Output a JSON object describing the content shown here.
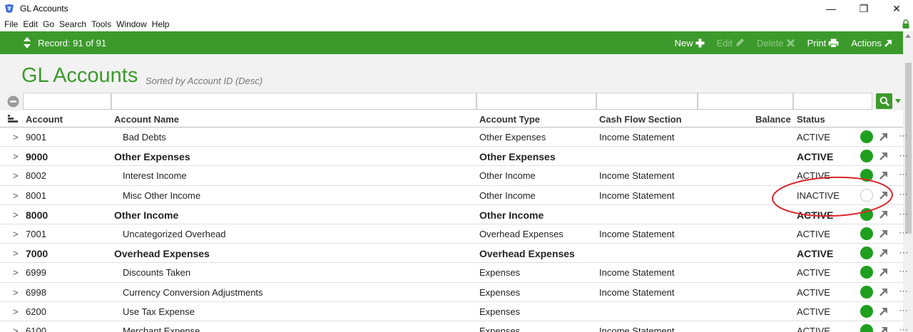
{
  "window": {
    "title": "GL Accounts",
    "minimize": "—",
    "maximize": "❐",
    "close": "✕"
  },
  "menu": [
    "File",
    "Edit",
    "Go",
    "Search",
    "Tools",
    "Window",
    "Help"
  ],
  "toolbar": {
    "record": "Record: 91 of 91",
    "new": "New",
    "edit": "Edit",
    "delete": "Delete",
    "print": "Print",
    "actions": "Actions"
  },
  "page": {
    "title": "GL Accounts",
    "sort_note": "Sorted by Account ID (Desc)"
  },
  "filters": [
    "",
    "",
    "",
    "",
    "",
    ""
  ],
  "columns": {
    "account": "Account",
    "name": "Account Name",
    "type": "Account Type",
    "cashflow": "Cash Flow Section",
    "balance": "Balance",
    "status": "Status"
  },
  "rows": [
    {
      "chev": ">",
      "account": "9001",
      "name": "Bad Debts",
      "type": "Other Expenses",
      "cashflow": "Income Statement",
      "balance": "",
      "status": "ACTIVE",
      "active": true,
      "header": false
    },
    {
      "chev": ">",
      "account": "9000",
      "name": "Other Expenses",
      "type": "Other Expenses",
      "cashflow": "",
      "balance": "",
      "status": "ACTIVE",
      "active": true,
      "header": true
    },
    {
      "chev": ">",
      "account": "8002",
      "name": "Interest Income",
      "type": "Other Income",
      "cashflow": "Income Statement",
      "balance": "",
      "status": "ACTIVE",
      "active": true,
      "header": false
    },
    {
      "chev": ">",
      "account": "8001",
      "name": "Misc Other Income",
      "type": "Other Income",
      "cashflow": "Income Statement",
      "balance": "",
      "status": "INACTIVE",
      "active": false,
      "header": false
    },
    {
      "chev": ">",
      "account": "8000",
      "name": "Other Income",
      "type": "Other Income",
      "cashflow": "",
      "balance": "",
      "status": "ACTIVE",
      "active": true,
      "header": true
    },
    {
      "chev": ">",
      "account": "7001",
      "name": "Uncategorized Overhead",
      "type": "Overhead Expenses",
      "cashflow": "Income Statement",
      "balance": "",
      "status": "ACTIVE",
      "active": true,
      "header": false
    },
    {
      "chev": ">",
      "account": "7000",
      "name": "Overhead Expenses",
      "type": "Overhead Expenses",
      "cashflow": "",
      "balance": "",
      "status": "ACTIVE",
      "active": true,
      "header": true
    },
    {
      "chev": ">",
      "account": "6999",
      "name": "Discounts Taken",
      "type": "Expenses",
      "cashflow": "Income Statement",
      "balance": "",
      "status": "ACTIVE",
      "active": true,
      "header": false
    },
    {
      "chev": ">",
      "account": "6998",
      "name": "Currency Conversion Adjustments",
      "type": "Expenses",
      "cashflow": "Income Statement",
      "balance": "",
      "status": "ACTIVE",
      "active": true,
      "header": false
    },
    {
      "chev": ">",
      "account": "6200",
      "name": "Use Tax Expense",
      "type": "Expenses",
      "cashflow": "",
      "balance": "",
      "status": "ACTIVE",
      "active": true,
      "header": false
    },
    {
      "chev": ">",
      "account": "6100",
      "name": "Merchant Expense",
      "type": "Expenses",
      "cashflow": "Income Statement",
      "balance": "",
      "status": "ACTIVE",
      "active": true,
      "header": false
    }
  ],
  "colors": {
    "brand_green": "#3c9a2c",
    "status_active": "#1e9f1e",
    "annotation_red": "#d9262c"
  }
}
